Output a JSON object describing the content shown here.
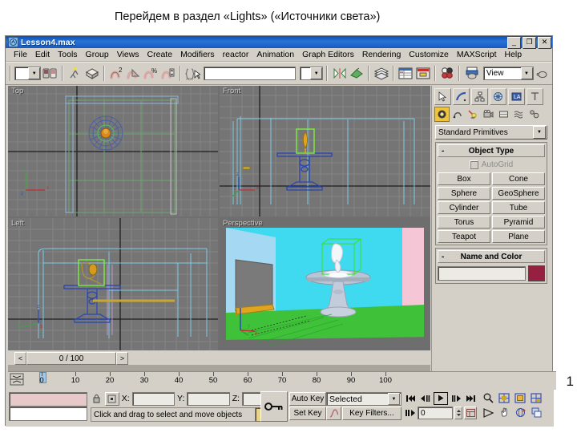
{
  "slide": {
    "caption": "Перейдем в раздел «Lights» («Источники света»)",
    "page_number": "1"
  },
  "window": {
    "title": "Lesson4.max",
    "app_icon": "max-app-icon",
    "controls": {
      "minimize": "_",
      "restore": "❐",
      "close": "✕"
    }
  },
  "menubar": {
    "items": [
      {
        "label": "File"
      },
      {
        "label": "Edit"
      },
      {
        "label": "Tools"
      },
      {
        "label": "Group"
      },
      {
        "label": "Views"
      },
      {
        "label": "Create"
      },
      {
        "label": "Modifiers"
      },
      {
        "label": "reactor"
      },
      {
        "label": "Animation"
      },
      {
        "label": "Graph Editors"
      },
      {
        "label": "Rendering"
      },
      {
        "label": "Customize"
      },
      {
        "label": "MAXScript"
      },
      {
        "label": "Help"
      }
    ]
  },
  "toolbar": {
    "undo_dropdown": "",
    "named_selection_value": "",
    "view_dropdown_value": "View",
    "icons": [
      "undo-dropdown-icon",
      "select-link-icon",
      "unlink-icon",
      "bind-space-warp-icon",
      "select-object-icon",
      "select-region-icon",
      "select-by-name-icon",
      "select-and-move-icon",
      "select-and-rotate-icon",
      "select-and-scale-icon",
      "reference-coordinate-icon",
      "mirror-icon",
      "align-icon",
      "layer-manager-icon",
      "curve-editor-icon",
      "schematic-view-icon",
      "material-editor-icon",
      "render-scene-icon",
      "quick-render-icon"
    ]
  },
  "viewports": [
    {
      "name": "Top",
      "label": "Top",
      "active": false
    },
    {
      "name": "Front",
      "label": "Front",
      "active": false
    },
    {
      "name": "Left",
      "label": "Left",
      "active": false
    },
    {
      "name": "Perspective",
      "label": "Perspective",
      "active": true
    }
  ],
  "command_panel": {
    "tabs": [
      {
        "name": "create-tab",
        "icon": "arrow-cursor-icon"
      },
      {
        "name": "modify-tab",
        "icon": "curve-icon"
      },
      {
        "name": "hierarchy-tab",
        "icon": "hierarchy-icon"
      },
      {
        "name": "motion-tab",
        "icon": "wheel-icon"
      },
      {
        "name": "display-tab",
        "icon": "display-icon"
      },
      {
        "name": "utilities-tab",
        "icon": "hammer-icon"
      }
    ],
    "category_icons": [
      {
        "name": "geometry-icon",
        "selected": true
      },
      {
        "name": "shapes-icon",
        "selected": false
      },
      {
        "name": "lights-icon",
        "selected": false
      },
      {
        "name": "cameras-icon",
        "selected": false
      },
      {
        "name": "helpers-icon",
        "selected": false
      },
      {
        "name": "space-warps-icon",
        "selected": false
      },
      {
        "name": "systems-icon",
        "selected": false
      }
    ],
    "subcategory_value": "Standard Primitives",
    "object_type": {
      "title": "Object Type",
      "collapse": "-",
      "autogrid_label": "AutoGrid",
      "autogrid_checked": false,
      "buttons": [
        "Box",
        "Cone",
        "Sphere",
        "GeoSphere",
        "Cylinder",
        "Tube",
        "Torus",
        "Pyramid",
        "Teapot",
        "Plane"
      ]
    },
    "name_and_color": {
      "title": "Name and Color",
      "collapse": "-",
      "name_value": "",
      "color": "#96203f"
    }
  },
  "timeline": {
    "slider_label": "0 / 100",
    "prev_arrow": "<",
    "next_arrow": ">",
    "ruler_ticks": [
      "0",
      "10",
      "20",
      "30",
      "40",
      "50",
      "60",
      "70",
      "80",
      "90",
      "100"
    ]
  },
  "status_bar": {
    "prompt": "Click and drag to select and move objects",
    "lock_icon": "lock-icon",
    "absolute_mode_icon": "absolute-relative-icon",
    "coords": [
      {
        "label": "X:",
        "value": ""
      },
      {
        "label": "Y:",
        "value": ""
      },
      {
        "label": "Z:",
        "value": ""
      }
    ],
    "key_mode_icon": "key-icon",
    "auto_key_label": "Auto Key",
    "set_key_label": "Set Key",
    "selection_set_value": "Selected",
    "key_filters_label": "Key Filters...",
    "curve_icon": "animation-curve-icon",
    "frame_value": "0",
    "playback_icons": [
      "go-to-start-icon",
      "previous-frame-icon",
      "play-icon",
      "next-frame-icon",
      "go-to-end-icon",
      "key-mode-toggle-icon",
      "current-frame-spinner-icon",
      "time-configuration-icon"
    ],
    "nav_icons": [
      "zoom-icon",
      "zoom-all-icon",
      "zoom-extents-icon",
      "zoom-region-icon",
      "field-of-view-icon",
      "pan-icon",
      "arc-rotate-icon",
      "min-max-toggle-icon"
    ]
  }
}
